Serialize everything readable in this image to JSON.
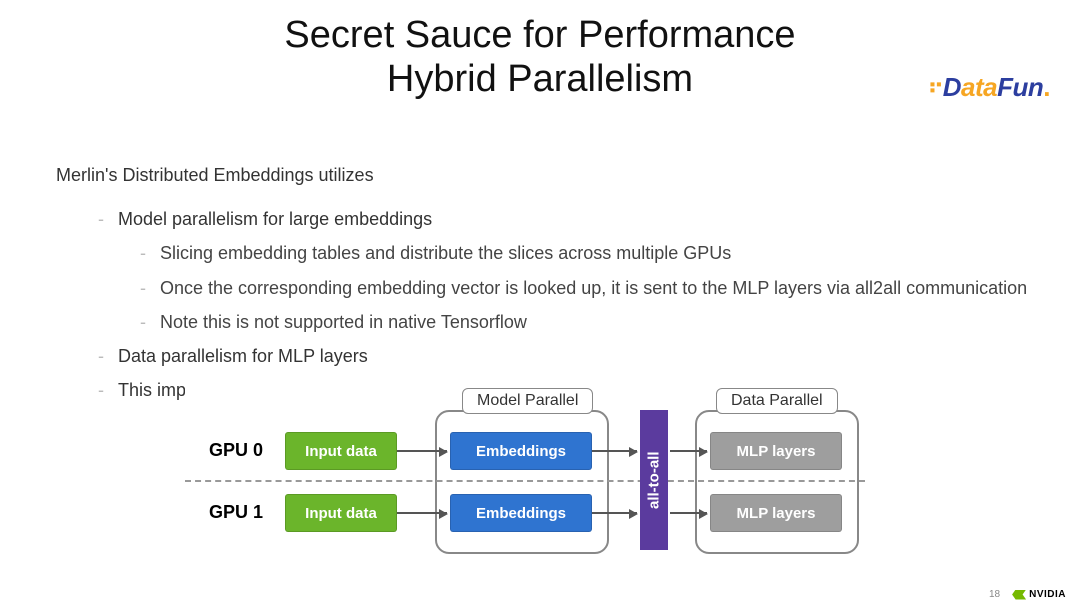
{
  "title_line1": "Secret Sauce for Performance",
  "title_line2": "Hybrid Parallelism",
  "logo": {
    "dots": "⠖",
    "d": "D",
    "ata": "ata",
    "fun": "Fun",
    "dot": "."
  },
  "intro": "Merlin's Distributed Embeddings utilizes",
  "bullets": {
    "b1": "Model parallelism for large embeddings",
    "b1a": "Slicing embedding tables and distribute the slices across multiple GPUs",
    "b1b": "Once the corresponding embedding vector is looked up, it is sent to the MLP layers via all2all communication",
    "b1c": "Note this is not supported in native Tensorflow",
    "b2": "Data parallelism for MLP layers",
    "b3": "This improves"
  },
  "diagram": {
    "gpu0": "GPU 0",
    "gpu1": "GPU 1",
    "input": "Input data",
    "emb": "Embeddings",
    "mlp": "MLP layers",
    "a2a": "all-to-all",
    "model_parallel": "Model Parallel",
    "data_parallel": "Data Parallel"
  },
  "footer": {
    "page": "18",
    "brand": "NVIDIA"
  }
}
